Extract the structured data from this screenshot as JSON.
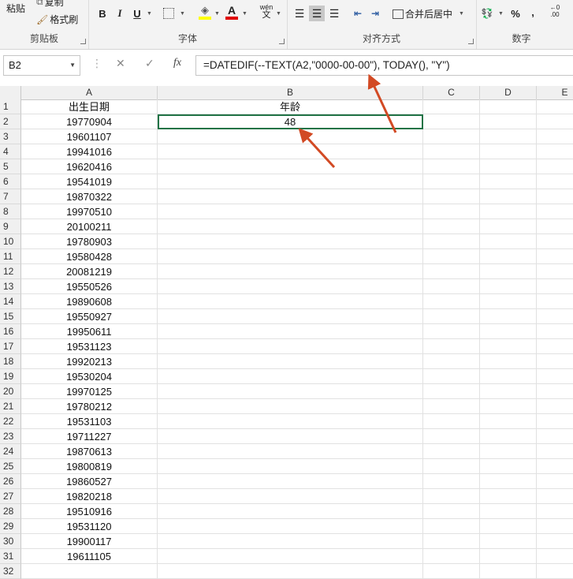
{
  "ribbon": {
    "clipboard": {
      "paste": "粘贴",
      "copy": "复制",
      "format_painter": "格式刷",
      "label": "剪贴板"
    },
    "font": {
      "bold": "B",
      "italic": "I",
      "underline": "U",
      "label": "字体",
      "wen": "wén",
      "wen_char": "文"
    },
    "alignment": {
      "merge_center": "合并后居中",
      "label": "对齐方式"
    },
    "number": {
      "percent": "%",
      "comma": ",",
      "label": "数字",
      "dec_inc": "←0",
      "dec_zero": ".00"
    }
  },
  "formula_bar": {
    "name_box": "B2",
    "fx": "fx",
    "formula": "=DATEDIF(--TEXT(A2,\"0000-00-00\"), TODAY(), \"Y\")"
  },
  "sheet": {
    "columns": [
      "A",
      "B",
      "C",
      "D",
      "E"
    ],
    "rows": [
      {
        "n": "1",
        "a": "出生日期",
        "b": "年龄"
      },
      {
        "n": "2",
        "a": "19770904",
        "b": "48"
      },
      {
        "n": "3",
        "a": "19601107",
        "b": ""
      },
      {
        "n": "4",
        "a": "19941016",
        "b": ""
      },
      {
        "n": "5",
        "a": "19620416",
        "b": ""
      },
      {
        "n": "6",
        "a": "19541019",
        "b": ""
      },
      {
        "n": "7",
        "a": "19870322",
        "b": ""
      },
      {
        "n": "8",
        "a": "19970510",
        "b": ""
      },
      {
        "n": "9",
        "a": "20100211",
        "b": ""
      },
      {
        "n": "10",
        "a": "19780903",
        "b": ""
      },
      {
        "n": "11",
        "a": "19580428",
        "b": ""
      },
      {
        "n": "12",
        "a": "20081219",
        "b": ""
      },
      {
        "n": "13",
        "a": "19550526",
        "b": ""
      },
      {
        "n": "14",
        "a": "19890608",
        "b": ""
      },
      {
        "n": "15",
        "a": "19550927",
        "b": ""
      },
      {
        "n": "16",
        "a": "19950611",
        "b": ""
      },
      {
        "n": "17",
        "a": "19531123",
        "b": ""
      },
      {
        "n": "18",
        "a": "19920213",
        "b": ""
      },
      {
        "n": "19",
        "a": "19530204",
        "b": ""
      },
      {
        "n": "20",
        "a": "19970125",
        "b": ""
      },
      {
        "n": "21",
        "a": "19780212",
        "b": ""
      },
      {
        "n": "22",
        "a": "19531103",
        "b": ""
      },
      {
        "n": "23",
        "a": "19711227",
        "b": ""
      },
      {
        "n": "24",
        "a": "19870613",
        "b": ""
      },
      {
        "n": "25",
        "a": "19800819",
        "b": ""
      },
      {
        "n": "26",
        "a": "19860527",
        "b": ""
      },
      {
        "n": "27",
        "a": "19820218",
        "b": ""
      },
      {
        "n": "28",
        "a": "19510916",
        "b": ""
      },
      {
        "n": "29",
        "a": "19531120",
        "b": ""
      },
      {
        "n": "30",
        "a": "19900117",
        "b": ""
      },
      {
        "n": "31",
        "a": "19611105",
        "b": ""
      },
      {
        "n": "32",
        "a": "",
        "b": ""
      }
    ]
  },
  "colors": {
    "arrow": "#d24a24",
    "selection": "#217346",
    "ribbon_bg": "#f3f3f3",
    "header_bg": "#f0f0f0"
  }
}
